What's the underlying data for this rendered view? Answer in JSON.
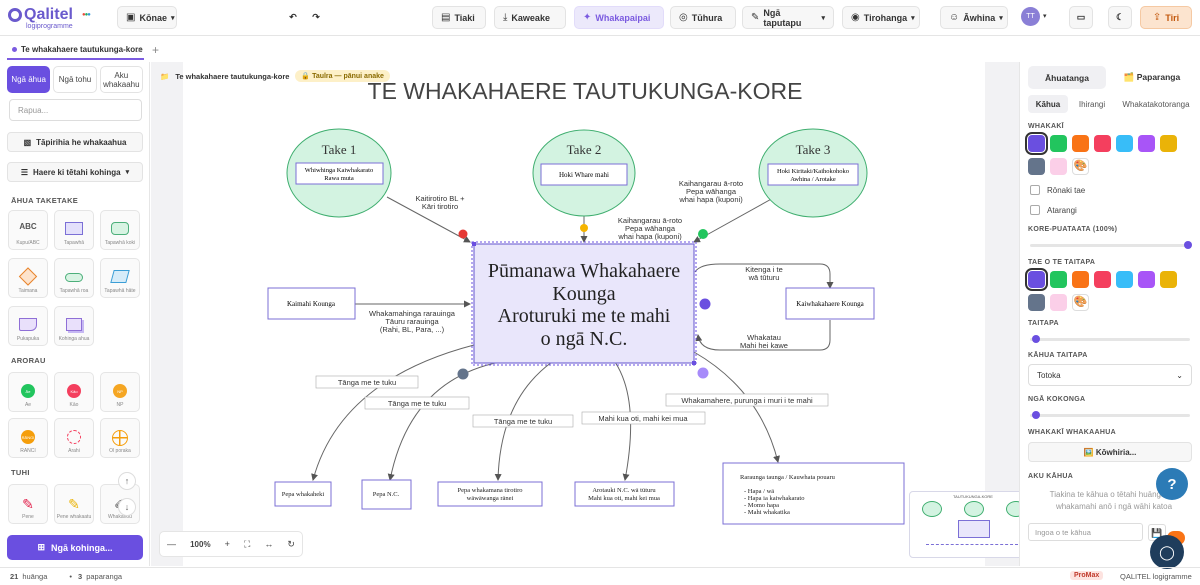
{
  "app": {
    "logo_text": "Qalitel",
    "logo_sub": "logiprogramme",
    "workspace": "Kōnae"
  },
  "toolbar": {
    "save": "Tiaki",
    "download": "Kaweake",
    "present": "Whakapaipai",
    "review": "Tūhura",
    "settings": "Ngā taputapu",
    "view": "Tirohanga",
    "help": "Āwhina",
    "user_initials": "TT",
    "share": "Tiri"
  },
  "tab": {
    "title": "Te whakahaere tautukunga-kore"
  },
  "breadcrumb": {
    "title": "Te whakahaere tautukunga-kore",
    "badge": "🔒 Taulra — pānui anake"
  },
  "left": {
    "tabs": [
      "Ngā āhua",
      "Ngā tohu",
      "Aku whakaahu"
    ],
    "search_placeholder": "Rapua...",
    "upload": "Tāpirihia he whakaahua",
    "move": "Haere ki tētahi kohinga",
    "sec_basic": "ĀHUA TAKETAKE",
    "basic": [
      "Kupu/ABC",
      "Tapawhā",
      "Tapawhā koki",
      "Taimana",
      "Tapawhā roa",
      "Tapawhā hāte",
      "Pukapuka",
      "Kohinga ahua"
    ],
    "sec_arrows": "ARORAU",
    "arrows": [
      "Āe",
      "Kāo",
      "NP",
      "RANCI",
      "Ārahi",
      "Ōl poraka"
    ],
    "arrow_codes": [
      "Āe",
      "Kāo",
      "NP",
      "RĀNGI",
      "",
      ""
    ],
    "sec_draw": "TUHI",
    "draw": [
      "Pene",
      "Pene whakaatu",
      "Whakahou"
    ],
    "add_btn": "Ngā kohinga..."
  },
  "diagram": {
    "title": "TE WHAKAHAERE TAUTUKUNGA-KORE",
    "center": [
      "Pūmanawa Whakahaere",
      "Kounga",
      "Aroturuki me te mahi",
      "o ngā N.C."
    ],
    "take1": {
      "title": "Take 1",
      "box": [
        "Whiwhinga Kaiwhakarato",
        "Rawa muta"
      ]
    },
    "take2": {
      "title": "Take 2",
      "box": [
        "Hoki Whare mahi"
      ]
    },
    "take3": {
      "title": "Take 3",
      "box": [
        "Hoki Kiritaki/Kaihokohoko",
        "Awhina / Arotake"
      ]
    },
    "left_box": "Kaimahi Kounga",
    "right_box": "Kaiwhakahaere Kounga",
    "lbl_t1": [
      "Kaitirotiro BL +",
      "Kāri tirotiro"
    ],
    "lbl_t2": [
      "Kaihangarau ā-roto",
      "Pepa wāhanga",
      "whai hapa (kuponi)"
    ],
    "lbl_t3": [
      "Kaihangarau ā-roto",
      "Pepa wāhanga",
      "whai hapa (kuponi)"
    ],
    "lbl_left": [
      "Whakamahinga rarauinga",
      "Tāuru rarauinga",
      "(Rahi, BL, Para, ...)"
    ],
    "lbl_right_top": [
      "Kitenga i te",
      "wā tūturu"
    ],
    "lbl_right_bot": [
      "Whakatau",
      "Mahi hei kawe"
    ],
    "branch_labels": [
      "Tānga me te tuku",
      "Tānga me te tuku",
      "Tānga me te tuku",
      "Mahi kua oti, mahi kei mua",
      "Whakamahere, purunga i muri i te mahi"
    ],
    "bottom": [
      "Pepa whakaheki",
      "Pepa N.C.",
      "Pepa whakamana tirotiro",
      "wāwāwanga rānei",
      "Arotauki N.C. wā tūturu",
      "Mahi kua oti, mahi kei mua"
    ],
    "list_title": "Raraunga taunga / Kauwhata pouaru",
    "list_items": [
      "Hapa / wā",
      "Hapa ia kaiwhakarato",
      "Momo hapa",
      "Mahi whakatika"
    ]
  },
  "zoom": {
    "level": "100%"
  },
  "minimap": {
    "title": "TAUTUKUNGA-KORE"
  },
  "right": {
    "tabs": [
      "Āhuatanga",
      "🗂️ Paparanga"
    ],
    "subtabs": [
      "Kāhua",
      "Ihirangi",
      "Whakatakotoranga"
    ],
    "fill": "WHAKAKĪ",
    "round": "Rōnaki tae",
    "shadow": "Atarangi",
    "opacity": "KORE-PUATAATA (100%)",
    "stroke": "TAE O TE TAITAPA",
    "stroke_w": "TAITAPA",
    "stroke_style": "KĀHUA TAITAPA",
    "stroke_value": "Totoka",
    "corner": "NGĀ KOKONGA",
    "image": "WHAKAKĪ WHAKAAHUA",
    "pick": "🖼️ Kōwhiria...",
    "style_h": "AKU KĀHUA",
    "empty": "Tiakina te kāhua o tētahi huānga hei whakamahi anō i ngā wāhi katoa",
    "url_placeholder": "Ingoa o te kāhua"
  },
  "status": {
    "count": "21",
    "count_label": "huānga",
    "layers": "3",
    "layers_label": "paparanga",
    "promax": "ProMax",
    "brand": "QALITEL logigramme"
  },
  "colors": {
    "accent": "#6a4fe0",
    "green": "#22c55e",
    "orange": "#f97316",
    "red": "#f43f5e",
    "cyan": "#38bdf8",
    "purple": "#a855f7",
    "yellow": "#eab308",
    "slate": "#64748b",
    "pink": "#fbcfe8"
  }
}
